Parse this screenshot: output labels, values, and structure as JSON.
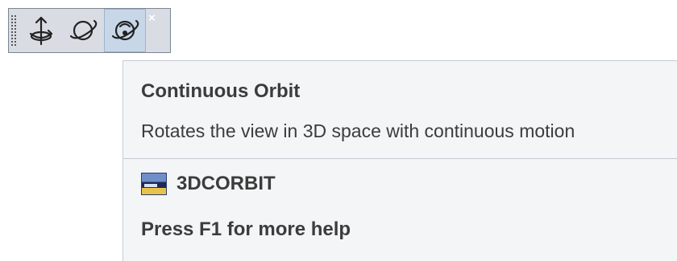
{
  "toolbar": {
    "buttons": [
      {
        "icon": "constrained-orbit-icon",
        "active": false
      },
      {
        "icon": "free-orbit-icon",
        "active": false
      },
      {
        "icon": "continuous-orbit-icon",
        "active": true
      }
    ],
    "close_glyph": "×"
  },
  "tooltip": {
    "title": "Continuous Orbit",
    "description": "Rotates the view in 3D space with continuous motion",
    "command_icon": "command-window-icon",
    "command": "3DCORBIT",
    "help": "Press F1 for more help"
  },
  "colors": {
    "toolbar_bg": "#d9dde3",
    "active_button_bg": "#c8d7e8",
    "tooltip_bg": "#f4f5f7",
    "text": "#3c3c3c"
  }
}
